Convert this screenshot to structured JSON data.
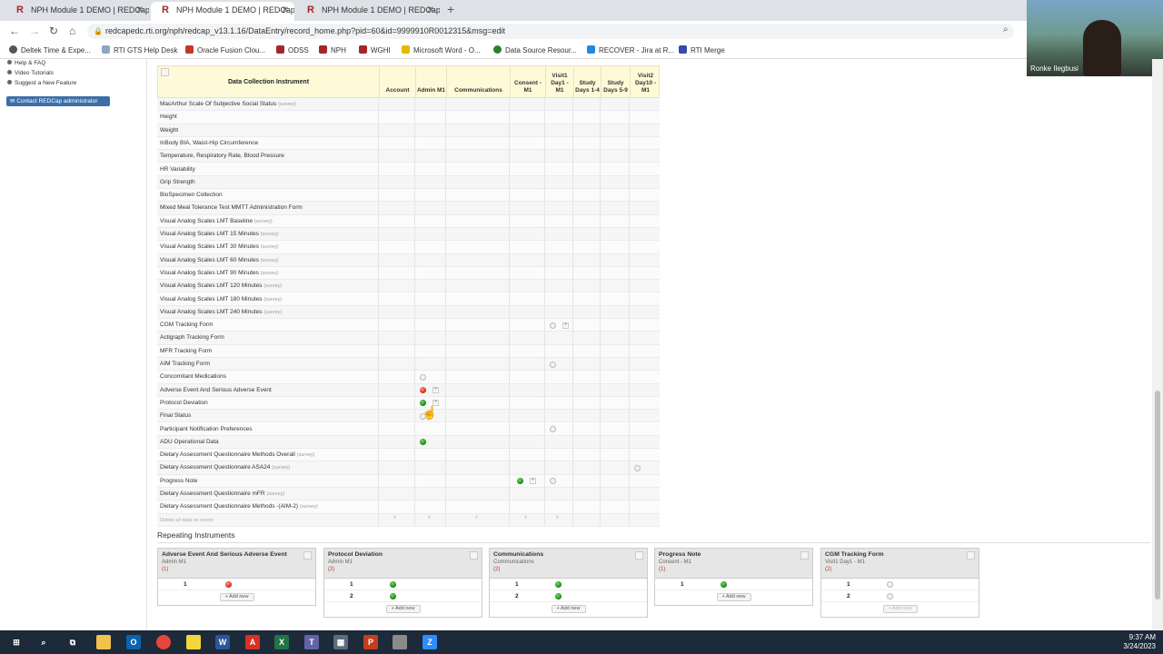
{
  "browser": {
    "tabs": [
      {
        "title": "NPH Module 1 DEMO | REDCap",
        "active": false
      },
      {
        "title": "NPH Module 1 DEMO | REDCap",
        "active": true
      },
      {
        "title": "NPH Module 1 DEMO | REDCap",
        "active": false
      }
    ],
    "url": "redcapedc.rti.org/nph/redcap_v13.1.16/DataEntry/record_home.php?pid=60&id=9999910R0012315&msg=edit",
    "bookmarks": [
      "Deltek Time & Expe...",
      "RTI GTS Help Desk",
      "Oracle Fusion Clou...",
      "ODSS",
      "NPH",
      "WGHI",
      "Microsoft Word - O...",
      "Data Source Resour...",
      "RECOVER - Jira at R...",
      "RTI Merge"
    ]
  },
  "video": {
    "name": "Ronke Ilegbusi"
  },
  "sidebar": {
    "links": [
      "Help & FAQ",
      "Video Tutorials",
      "Suggest a New Feature"
    ],
    "contact_button": "Contact REDCap administrator"
  },
  "grid": {
    "instrument_header": "Data Collection Instrument",
    "columns": [
      "Account",
      "Admin M1",
      "Communications",
      "Consent - M1",
      "Visit1 Day1 - M1",
      "Study Days 1-4",
      "Study Days 5-9",
      "Visit2 Day10 - M1"
    ],
    "rows": [
      {
        "label": "MacArthur Scale Of Subjective Social Status",
        "survey": "(survey)"
      },
      {
        "label": "Height",
        "survey": ""
      },
      {
        "label": "Weight",
        "survey": ""
      },
      {
        "label": "InBody BIA, Waist-Hip Circumference",
        "survey": ""
      },
      {
        "label": "Temperature, Respiratory Rate, Blood Pressure",
        "survey": ""
      },
      {
        "label": "HR Variability",
        "survey": ""
      },
      {
        "label": "Grip Strength",
        "survey": ""
      },
      {
        "label": "BioSpecimen Collection",
        "survey": ""
      },
      {
        "label": "Mixed Meal Tolerance Test MMTT Administration Form",
        "survey": ""
      },
      {
        "label": "Visual Analog Scales LMT Baseline",
        "survey": "(survey)"
      },
      {
        "label": "Visual Analog Scales LMT 15 Minutes",
        "survey": "(survey)"
      },
      {
        "label": "Visual Analog Scales LMT 30 Minutes",
        "survey": "(survey)"
      },
      {
        "label": "Visual Analog Scales LMT 60 Minutes",
        "survey": "(survey)"
      },
      {
        "label": "Visual Analog Scales LMT 90 Minutes",
        "survey": "(survey)"
      },
      {
        "label": "Visual Analog Scales LMT 120 Minutes",
        "survey": "(survey)"
      },
      {
        "label": "Visual Analog Scales LMT 180 Minutes",
        "survey": "(survey)"
      },
      {
        "label": "Visual Analog Scales LMT 240 Minutes",
        "survey": "(survey)"
      },
      {
        "label": "CGM Tracking Form",
        "survey": ""
      },
      {
        "label": "Actigraph Tracking Form",
        "survey": ""
      },
      {
        "label": "MFR Tracking Form",
        "survey": ""
      },
      {
        "label": "AIM Tracking Form",
        "survey": ""
      },
      {
        "label": "Concomitant Medications",
        "survey": ""
      },
      {
        "label": "Adverse Event And Serious Adverse Event",
        "survey": ""
      },
      {
        "label": "Protocol Deviation",
        "survey": ""
      },
      {
        "label": "Final Status",
        "survey": ""
      },
      {
        "label": "Participant Notification Preferences",
        "survey": ""
      },
      {
        "label": "ADU Operational Data",
        "survey": ""
      },
      {
        "label": "Dietary Assessment Questionnaire Methods Overall",
        "survey": "(survey)"
      },
      {
        "label": "Dietary Assessment Questionnaire ASA24",
        "survey": "(survey)"
      },
      {
        "label": "Progress Note",
        "survey": ""
      },
      {
        "label": "Dietary Assessment Questionnaire mFR",
        "survey": "(survey)"
      },
      {
        "label": "Dietary Assessment Questionnaire Methods -(AIM-2)",
        "survey": "(survey)"
      },
      {
        "label": "Delete all data on event:",
        "survey": ""
      }
    ],
    "delete_marks": [
      "x",
      "x",
      "x",
      "x",
      "x"
    ]
  },
  "repeating": {
    "title": "Repeating Instruments",
    "cards": [
      {
        "title": "Adverse Event And Serious Adverse Event",
        "sub": "Admin M1",
        "count": "(1)",
        "rows": [
          "1"
        ],
        "add": "+ Add new"
      },
      {
        "title": "Protocol Deviation",
        "sub": "Admin M1",
        "count": "(2)",
        "rows": [
          "1",
          "2"
        ],
        "add": "+ Add new"
      },
      {
        "title": "Communications",
        "sub": "Communications",
        "count": "(2)",
        "rows": [
          "1",
          "2"
        ],
        "add": "+ Add new"
      },
      {
        "title": "Progress Note",
        "sub": "Consent - M1",
        "count": "(1)",
        "rows": [
          "1"
        ],
        "add": "+ Add new"
      },
      {
        "title": "CGM Tracking Form",
        "sub": "Visit1 Day1 - M1",
        "count": "(2)",
        "rows": [
          "1",
          "2"
        ],
        "add": "+ Add new"
      }
    ]
  },
  "taskbar": {
    "time": "9:37 AM",
    "date": "3/24/2023"
  }
}
